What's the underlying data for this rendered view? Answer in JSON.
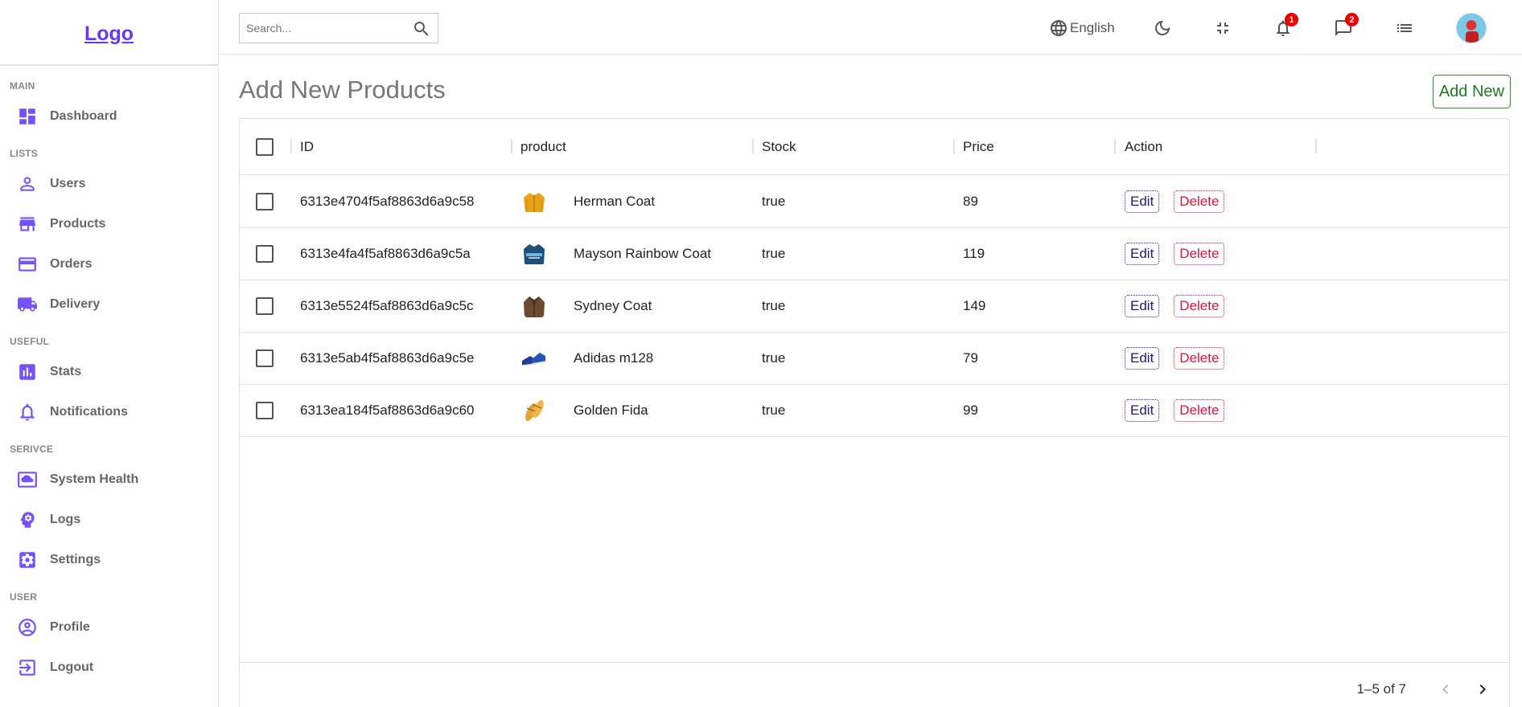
{
  "sidebar": {
    "logo": "Logo",
    "sections": {
      "main": "MAIN",
      "lists": "LISTS",
      "useful": "USEFUL",
      "service": "SERIVCE",
      "user": "USER"
    },
    "items": {
      "dashboard": "Dashboard",
      "users": "Users",
      "products": "Products",
      "orders": "Orders",
      "delivery": "Delivery",
      "stats": "Stats",
      "notifications": "Notifications",
      "system_health": "System Health",
      "logs": "Logs",
      "settings": "Settings",
      "profile": "Profile",
      "logout": "Logout"
    },
    "accent_color": "#7451f8"
  },
  "topbar": {
    "search_placeholder": "Search...",
    "language": "English",
    "notifications_count": "1",
    "messages_count": "2"
  },
  "main": {
    "title": "Add New Products",
    "add_new_label": "Add New"
  },
  "table": {
    "columns": [
      "ID",
      "product",
      "Stock",
      "Price",
      "Action"
    ],
    "rows": [
      {
        "id": "6313e4704f5af8863d6a9c58",
        "product": "Herman Coat",
        "stock": "true",
        "price": "89",
        "thumb": "yellow-jacket"
      },
      {
        "id": "6313e4fa4f5af8863d6a9c5a",
        "product": "Mayson Rainbow Coat",
        "stock": "true",
        "price": "119",
        "thumb": "blue-jacket"
      },
      {
        "id": "6313e5524f5af8863d6a9c5c",
        "product": "Sydney Coat",
        "stock": "true",
        "price": "149",
        "thumb": "brown-coat"
      },
      {
        "id": "6313e5ab4f5af8863d6a9c5e",
        "product": "Adidas m128",
        "stock": "true",
        "price": "79",
        "thumb": "blue-shoes"
      },
      {
        "id": "6313ea184f5af8863d6a9c60",
        "product": "Golden Fida",
        "stock": "true",
        "price": "99",
        "thumb": "golden-sandals"
      }
    ],
    "edit_label": "Edit",
    "delete_label": "Delete",
    "pagination": "1–5 of 7"
  }
}
